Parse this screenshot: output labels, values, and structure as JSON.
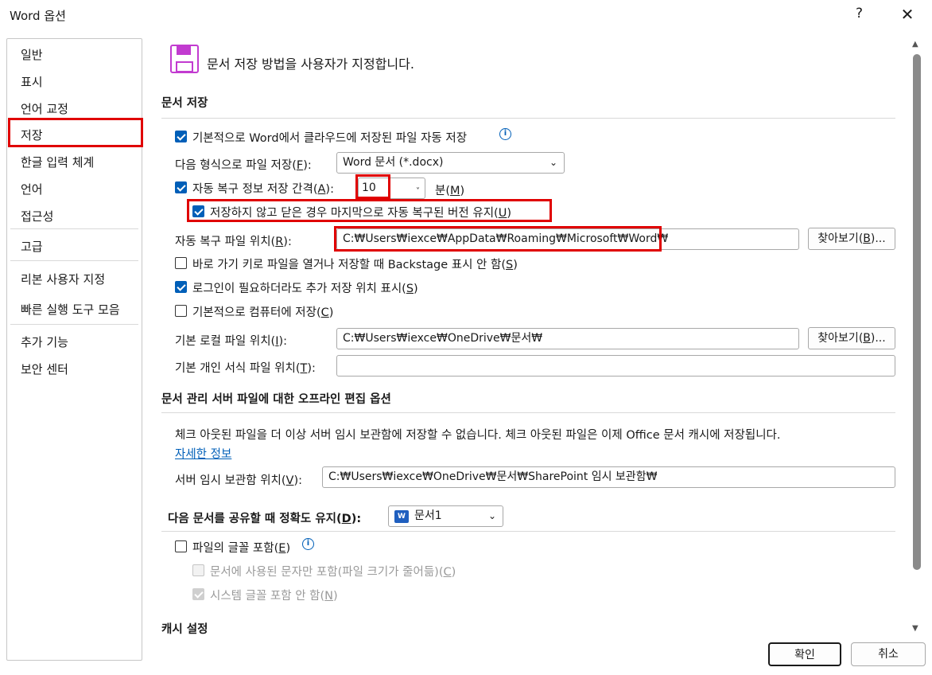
{
  "window": {
    "title": "Word 옵션",
    "help": "?",
    "close": "✕"
  },
  "sidebar": {
    "items": [
      {
        "label": "일반"
      },
      {
        "label": "표시"
      },
      {
        "label": "언어 교정"
      },
      {
        "label": "저장"
      },
      {
        "label": "한글 입력 체계"
      },
      {
        "label": "언어"
      },
      {
        "label": "접근성"
      },
      {
        "label": "고급"
      },
      {
        "label": "리본 사용자 지정"
      },
      {
        "label": "빠른 실행 도구 모음"
      },
      {
        "label": "추가 기능"
      },
      {
        "label": "보안 센터"
      }
    ],
    "active": "저장"
  },
  "header": {
    "text": "문서 저장 방법을 사용자가 지정합니다."
  },
  "save_docs": {
    "title": "문서 저장",
    "autosave_cloud": {
      "label": "기본적으로 Word에서 클라우드에 저장된 파일 자동 저장",
      "checked": true
    },
    "save_format": {
      "label": "다음 형식으로 파일 저장(",
      "key": "F",
      "suffix": "):",
      "value": "Word 문서 (*.docx)"
    },
    "autorecover": {
      "label": "자동 복구 정보 저장 간격(",
      "key": "A",
      "suffix": "):",
      "checked": true,
      "value": "10",
      "unit_label": "분(",
      "unit_key": "M",
      "unit_suffix": ")"
    },
    "keep_last": {
      "label": "저장하지 않고 닫은 경우 마지막으로 자동 복구된 버전 유지(",
      "key": "U",
      "suffix": ")",
      "checked": true
    },
    "autorecover_location": {
      "label": "자동 복구 파일 위치(",
      "key": "R",
      "suffix": "):",
      "value": "C:₩Users₩iexce₩AppData₩Roaming₩Microsoft₩Word₩",
      "browse_label": "찾아보기(",
      "browse_key": "B",
      "browse_suffix": ")..."
    },
    "no_backstage": {
      "label": "바로 가기 키로 파일을 열거나 저장할 때 Backstage 표시 안 함(",
      "key": "S",
      "suffix": ")",
      "checked": false
    },
    "show_locations": {
      "label": "로그인이 필요하더라도 추가 저장 위치 표시(",
      "key": "S",
      "suffix": ")",
      "checked": true
    },
    "save_computer": {
      "label": "기본적으로 컴퓨터에 저장(",
      "key": "C",
      "suffix": ")",
      "checked": false
    },
    "local_location": {
      "label": "기본 로컬 파일 위치(",
      "key": "I",
      "suffix": "):",
      "value": "C:₩Users₩iexce₩OneDrive₩문서₩",
      "browse_label": "찾아보기(",
      "browse_key": "B",
      "browse_suffix": ")..."
    },
    "template_location": {
      "label": "기본 개인 서식 파일 위치(",
      "key": "T",
      "suffix": "):",
      "value": ""
    }
  },
  "offline": {
    "title": "문서 관리 서버 파일에 대한 오프라인 편집 옵션",
    "desc": "체크 아웃된 파일을 더 이상 서버 임시 보관함에 저장할 수 없습니다. 체크 아웃된 파일은 이제 Office 문서 캐시에 저장됩니다.",
    "more_info": "자세한 정보",
    "drafts": {
      "label": "서버 임시 보관함 위치(",
      "key": "V",
      "suffix": "):",
      "value": "C:₩Users₩iexce₩OneDrive₩문서₩SharePoint 임시 보관함₩"
    }
  },
  "fidelity": {
    "title": "다음 문서를 공유할 때 정확도 유지(",
    "key": "D",
    "suffix": "):",
    "doc_value": "문서1",
    "embed_fonts": {
      "label": "파일의 글꼴 포함(",
      "key": "E",
      "suffix": ")",
      "checked": false
    },
    "only_used": {
      "label": "문서에 사용된 문자만 포함(파일 크기가 줄어듦)(",
      "key": "C",
      "suffix": ")",
      "checked": false
    },
    "no_system": {
      "label": "시스템 글꼴 포함 안 함(",
      "key": "N",
      "suffix": ")",
      "checked": true
    }
  },
  "cache": {
    "title": "캐시 설정"
  },
  "footer": {
    "ok": "확인",
    "cancel": "취소"
  },
  "colors": {
    "highlight": "#e00000",
    "accent": "#005fb8"
  }
}
